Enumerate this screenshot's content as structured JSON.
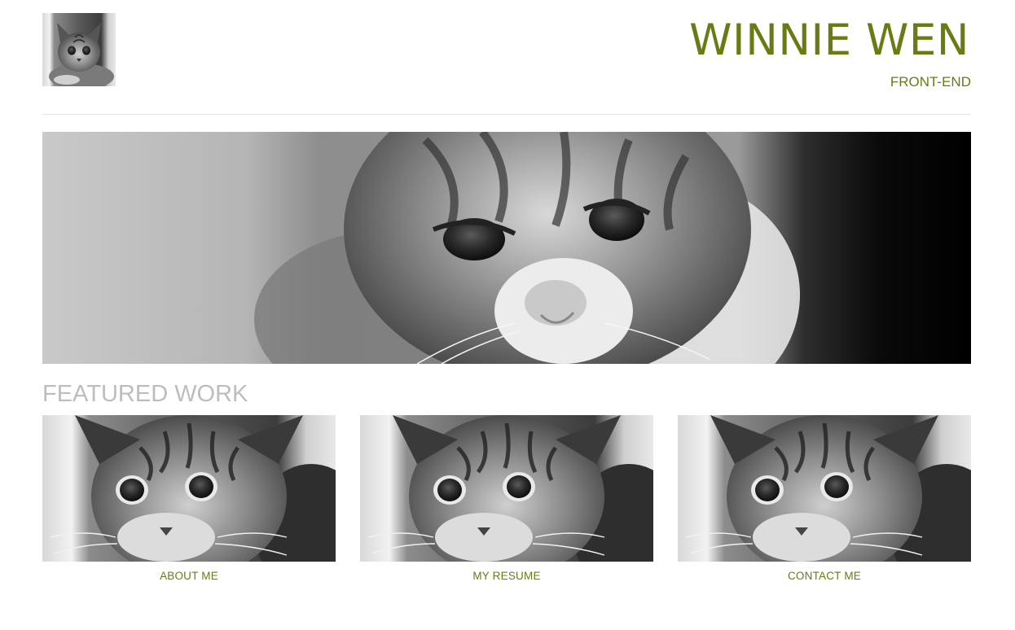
{
  "header": {
    "title": "WINNIE WEN",
    "subtitle": "FRONT-END",
    "logo_icon": "kitten-photo-icon"
  },
  "hero": {
    "image": "kitten-closeup-photo"
  },
  "featured": {
    "heading": "FEATURED WORK",
    "items": [
      {
        "label": "ABOUT ME",
        "image": "kitten-photo"
      },
      {
        "label": "MY RESUME",
        "image": "kitten-photo"
      },
      {
        "label": "CONTACT ME",
        "image": "kitten-photo"
      }
    ]
  },
  "colors": {
    "accent": "#6b7a12",
    "heading_gray": "#bdbdbd",
    "divider": "#e4e4e4",
    "background": "#ffffff"
  }
}
